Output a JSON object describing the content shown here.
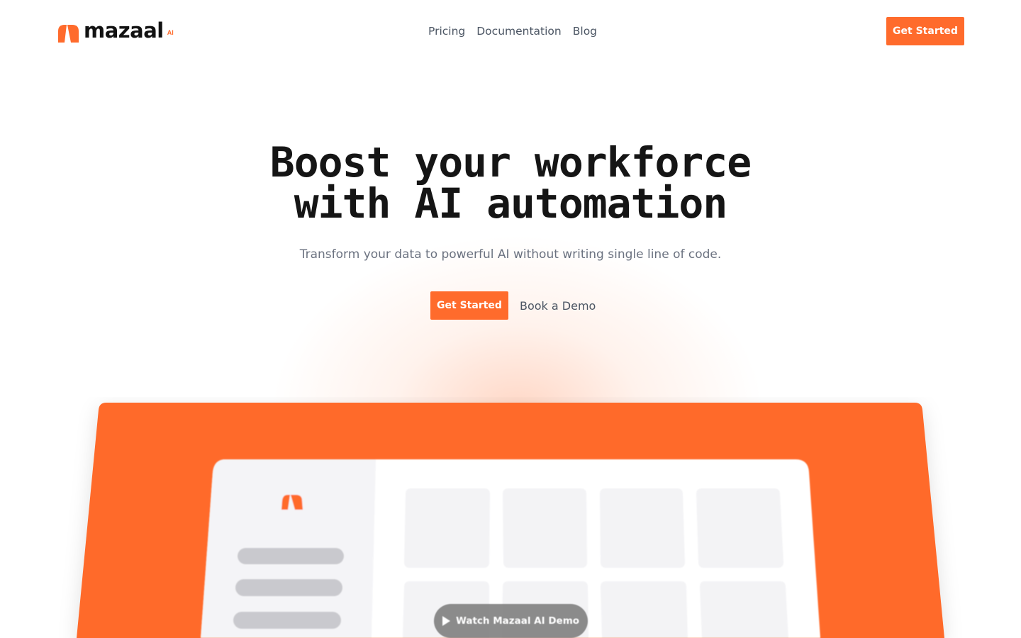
{
  "brand": {
    "name": "mazaal",
    "suffix": "AI",
    "accent": "#FF6B2C"
  },
  "nav": {
    "items": [
      {
        "label": "Pricing"
      },
      {
        "label": "Documentation"
      },
      {
        "label": "Blog"
      }
    ],
    "cta_label": "Get Started"
  },
  "hero": {
    "title_line1": "Boost your workforce",
    "title_line2": "with AI automation",
    "subtitle": "Transform your data to powerful AI without writing single line of code.",
    "primary_cta": "Get Started",
    "secondary_cta": "Book a Demo"
  },
  "showcase": {
    "watch_label": "Watch Mazaal AI Demo",
    "icons": {
      "play": "play-icon",
      "logo": "mazaal-logo-icon"
    }
  }
}
